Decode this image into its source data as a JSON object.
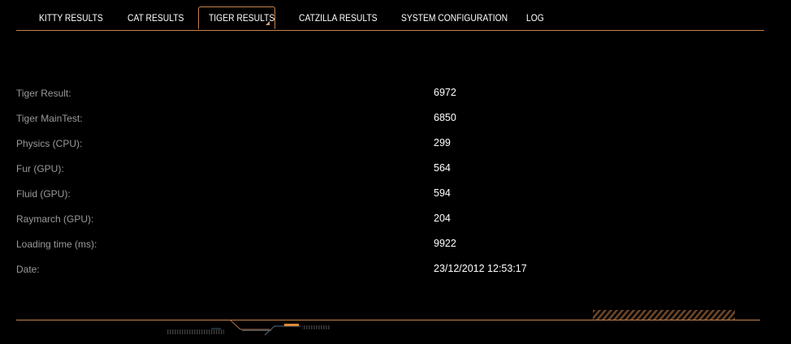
{
  "tabs": [
    {
      "label": "KITTY RESULTS",
      "active": false
    },
    {
      "label": "CAT RESULTS",
      "active": false
    },
    {
      "label": "TIGER RESULTS",
      "active": true
    },
    {
      "label": "CATZILLA RESULTS",
      "active": false
    },
    {
      "label": "SYSTEM CONFIGURATION",
      "active": false
    },
    {
      "label": "LOG",
      "active": false
    }
  ],
  "results": [
    {
      "label": "Tiger Result:",
      "value": "6972"
    },
    {
      "label": "Tiger MainTest:",
      "value": "6850"
    },
    {
      "label": "Physics (CPU):",
      "value": "299"
    },
    {
      "label": "Fur (GPU):",
      "value": "564"
    },
    {
      "label": "Fluid (GPU):",
      "value": "594"
    },
    {
      "label": "Raymarch (GPU):",
      "value": "204"
    },
    {
      "label": "Loading time (ms):",
      "value": "9922"
    },
    {
      "label": "Date:",
      "value": "23/12/2012 12:53:17"
    }
  ],
  "colors": {
    "accent": "#c8824a",
    "label": "#9a9a9a",
    "value": "#ffffff",
    "background": "#000000"
  }
}
